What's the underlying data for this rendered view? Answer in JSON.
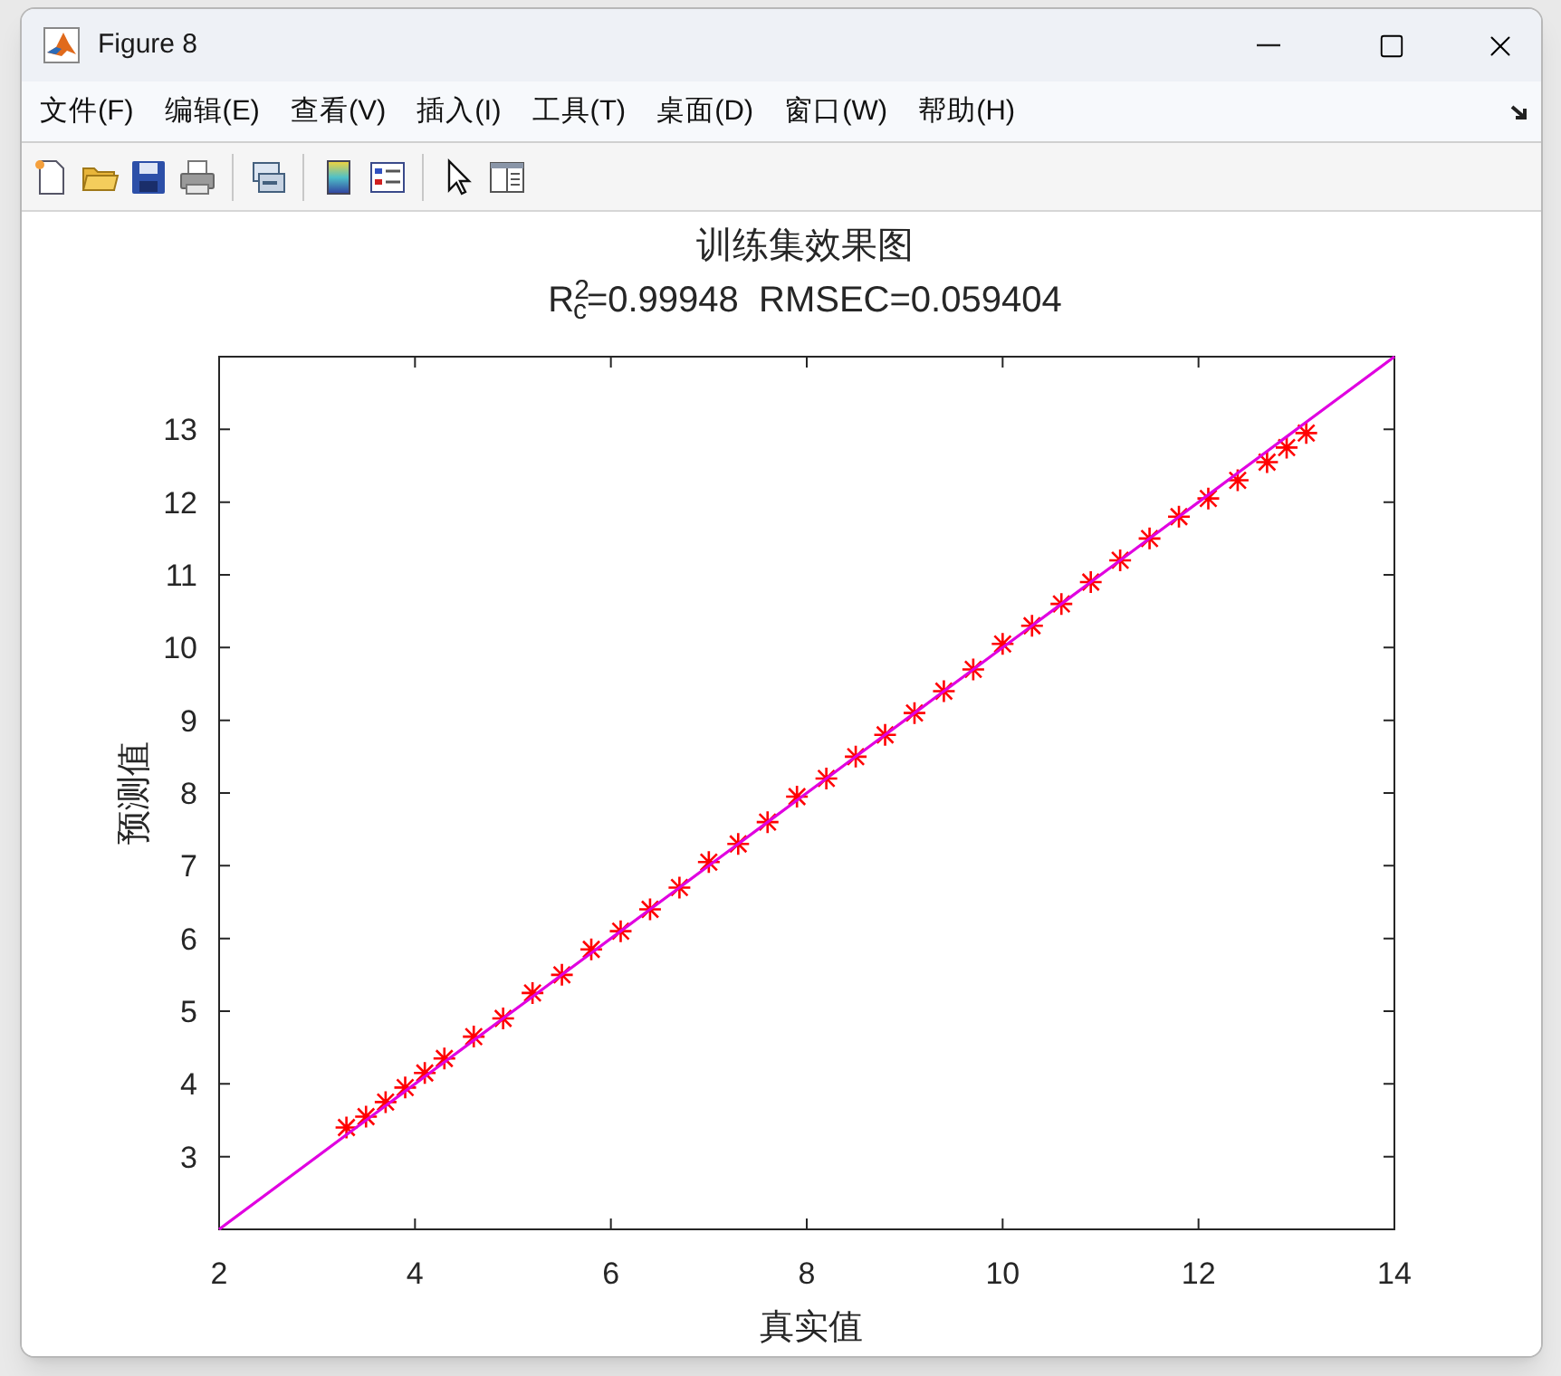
{
  "window": {
    "title": "Figure 8"
  },
  "menu": [
    {
      "label": "文件(F)"
    },
    {
      "label": "编辑(E)"
    },
    {
      "label": "查看(V)"
    },
    {
      "label": "插入(I)"
    },
    {
      "label": "工具(T)"
    },
    {
      "label": "桌面(D)"
    },
    {
      "label": "窗口(W)"
    },
    {
      "label": "帮助(H)"
    }
  ],
  "toolbar": [
    {
      "kind": "new"
    },
    {
      "kind": "open"
    },
    {
      "kind": "save"
    },
    {
      "kind": "print"
    },
    {
      "kind": "sep"
    },
    {
      "kind": "link"
    },
    {
      "kind": "sep"
    },
    {
      "kind": "colorbar"
    },
    {
      "kind": "legend"
    },
    {
      "kind": "sep"
    },
    {
      "kind": "pointer"
    },
    {
      "kind": "inspector"
    }
  ],
  "figure": {
    "title": "训练集效果图",
    "subtitle": "R$^{2}$$_{c}$=0.99948  RMSEC=0.059404",
    "chart_data": {
      "type": "scatter",
      "xlabel": "真实值",
      "ylabel": "预测值",
      "xlim": [
        2,
        14
      ],
      "ylim": [
        2,
        14
      ],
      "xticks": [
        2,
        4,
        6,
        8,
        10,
        12,
        14
      ],
      "yticks": [
        3,
        4,
        5,
        6,
        7,
        8,
        9,
        10,
        11,
        12,
        13
      ],
      "x": [
        2,
        3.3,
        3.5,
        3.7,
        3.9,
        4.1,
        4.3,
        4.6,
        4.9,
        5.2,
        5.5,
        5.8,
        6.1,
        6.4,
        6.7,
        7.0,
        7.3,
        7.6,
        7.9,
        8.2,
        8.5,
        8.8,
        9.1,
        9.4,
        9.7,
        10.0,
        10.3,
        10.6,
        10.9,
        11.2,
        11.5,
        11.8,
        12.1,
        12.4,
        12.7,
        12.9,
        13.1,
        14
      ],
      "series": [
        {
          "type": "scatter",
          "color": "#ff0000",
          "values": [
            null,
            3.4,
            3.55,
            3.75,
            3.95,
            4.15,
            4.35,
            4.65,
            4.9,
            5.25,
            5.5,
            5.85,
            6.1,
            6.4,
            6.7,
            7.05,
            7.3,
            7.6,
            7.95,
            8.2,
            8.5,
            8.8,
            9.1,
            9.4,
            9.7,
            10.05,
            10.3,
            10.6,
            10.9,
            11.2,
            11.5,
            11.8,
            12.05,
            12.3,
            12.55,
            12.75,
            12.95,
            null
          ]
        },
        {
          "type": "line",
          "color": "#e000e0",
          "values": [
            2,
            3.3,
            3.5,
            3.7,
            3.9,
            4.1,
            4.3,
            4.6,
            4.9,
            5.2,
            5.5,
            5.8,
            6.1,
            6.4,
            6.7,
            7.0,
            7.3,
            7.6,
            7.9,
            8.2,
            8.5,
            8.8,
            9.1,
            9.4,
            9.7,
            10.0,
            10.3,
            10.6,
            10.9,
            11.2,
            11.5,
            11.8,
            12.1,
            12.4,
            12.7,
            12.9,
            13.1,
            14
          ]
        }
      ]
    }
  }
}
